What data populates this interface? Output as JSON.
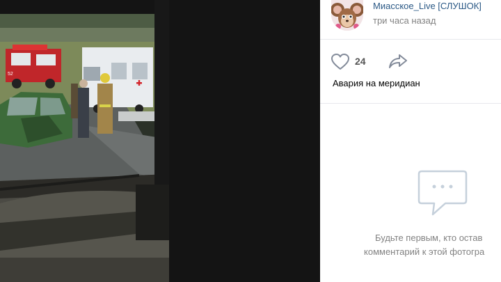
{
  "post": {
    "author": "Миасское_Live [СЛУШОК]",
    "time": "три часа назад",
    "likes": "24",
    "caption": "Авария на меридиан"
  },
  "comments": {
    "empty_line1": "Будьте первым, кто остав",
    "empty_line2": "комментарий к этой фотогра"
  },
  "photo": {
    "fire_truck_number": "52"
  },
  "icons": {
    "like": "heart-icon",
    "share": "share-arrow-icon",
    "empty": "comments-bubble-icon"
  },
  "colors": {
    "link": "#2a5885",
    "muted": "#828282",
    "divider": "#e7e8ec"
  }
}
